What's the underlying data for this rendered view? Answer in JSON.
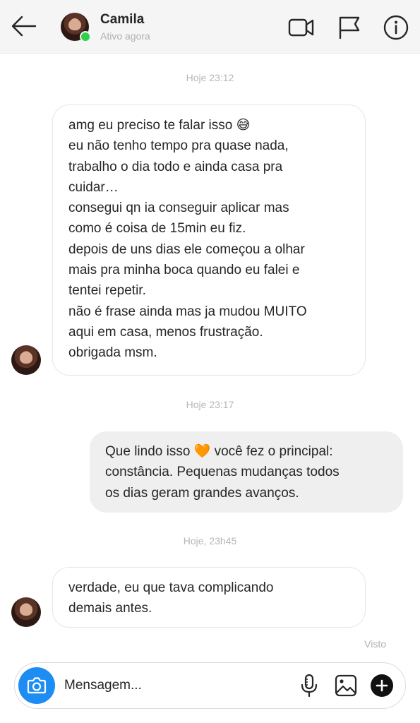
{
  "header": {
    "contact_name": "Camila",
    "status": "Ativo agora",
    "online_color": "#2fd14b"
  },
  "icons": {
    "back": "arrow-left-icon",
    "video": "video-camera-icon",
    "flag": "flag-icon",
    "info": "info-icon",
    "camera": "camera-icon",
    "mic": "microphone-icon",
    "gallery": "image-icon",
    "plus": "plus-circle-icon"
  },
  "thread": {
    "timestamps": [
      "Hoje 23:12",
      "Hoje 23:17",
      "Hoje, 23h45"
    ],
    "messages": [
      {
        "from": "Camila",
        "text": "amg eu preciso te falar isso 😅\neu não tenho tempo pra quase nada,\ntrabalho o dia todo e ainda casa pra\ncuidar…\nconsegui qn ia conseguir aplicar mas\ncomo é coisa de 15min eu fiz.\ndepois de uns dias ele começou a olhar\nmais pra minha boca quando eu falei e\ntentei repetir.\nnão é frase ainda mas ja mudou MUITO\naqui em casa, menos frustração.\nobrigada msm."
      },
      {
        "from": "me",
        "text": "Que lindo isso 🧡 você fez o principal:\nconstância. Pequenas mudanças todos\nos dias geram grandes avanços."
      },
      {
        "from": "Camila",
        "text": "verdade, eu que tava complicando\ndemais antes."
      }
    ],
    "seen": "Visto"
  },
  "composer": {
    "placeholder": "Mensagem...",
    "value": "",
    "accent": "#1e8df3"
  }
}
